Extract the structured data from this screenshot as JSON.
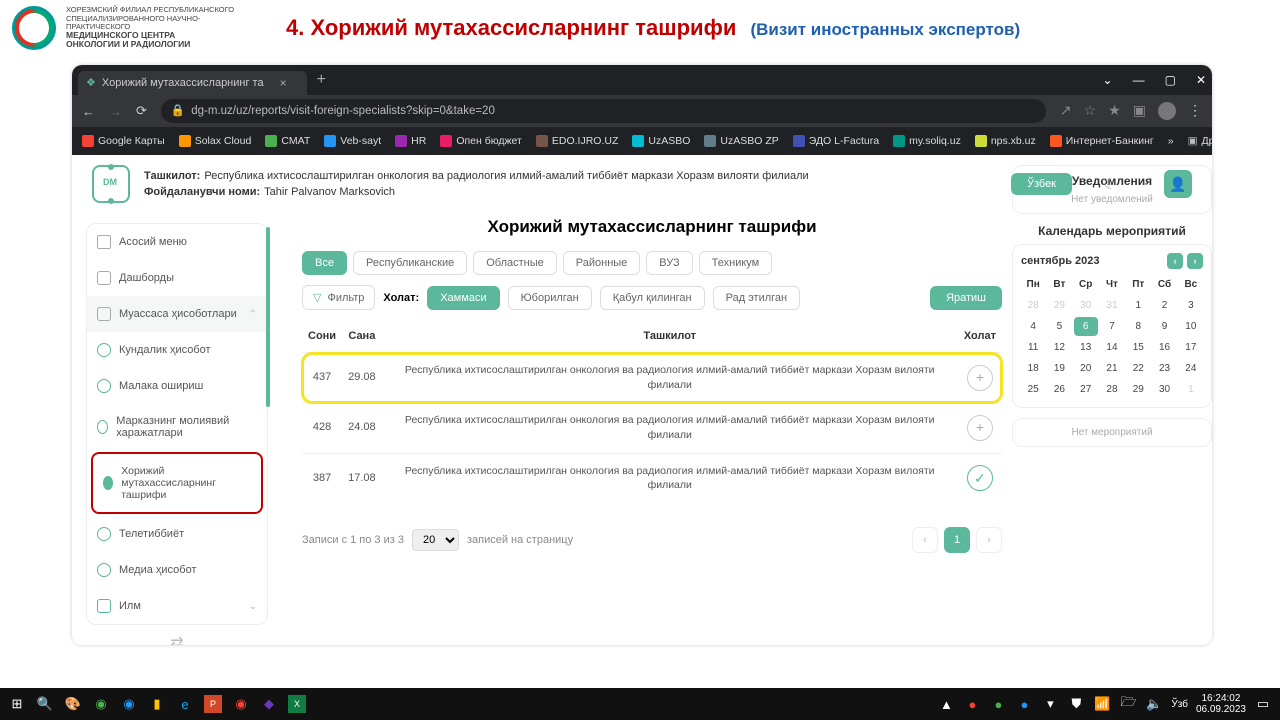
{
  "outer": {
    "org_line1": "ХОРЕЗМСКИЙ ФИЛИАЛ РЕСПУБЛИКАНСКОГО",
    "org_line2": "СПЕЦИАЛИЗИРОВАННОГО НАУЧНО-ПРАКТИЧЕСКОГО",
    "org_line3": "МЕДИЦИНСКОГО ЦЕНТРА",
    "org_line4": "ОНКОЛОГИИ И РАДИОЛОГИИ",
    "number": "4.",
    "title": "Хорижий мутахассисларнинг ташрифи",
    "subtitle": "(Визит иностранных экспертов)"
  },
  "chrome": {
    "tab": "Хорижий мутахассисларнинг та",
    "url": "dg-m.uz/uz/reports/visit-foreign-specialists?skip=0&take=20",
    "bookmarks": [
      "Google Карты",
      "Solax Cloud",
      "CMAT",
      "Veb-sayt",
      "HR",
      "Опен бюджет",
      "EDO.IJRO.UZ",
      "UzASBO",
      "UzASBO ZP",
      "ЭДО L-Factura",
      "my.soliq.uz",
      "nps.xb.uz",
      "Интернет-Банкинг"
    ],
    "bmk_more": "»",
    "bmk_folder": "Другие закладки"
  },
  "app": {
    "org_label": "Ташкилот:",
    "org_value": "Республика ихтисослаштирилган онкология ва радиология илмий-амалий тиббиёт маркази Хоразм вилояти филиали",
    "user_label": "Фойдаланувчи номи:",
    "user_value": "Tahir Palvanov Marksovich",
    "lang": "Ўзбек",
    "title": "Хорижий мутахассисларнинг ташрифи",
    "side": {
      "main_menu": "Асосий меню",
      "dashboards": "Дашборды",
      "institution": "Муассаса ҳисоботлари",
      "daily": "Кундалик ҳисобот",
      "training": "Малака ошириш",
      "finance": "Марказнинг молиявий харажатлари",
      "foreign": "Хорижий мутахассисларнинг ташрифи",
      "tele": "Телетиббиёт",
      "media": "Медиа ҳисобот",
      "science": "Илм"
    },
    "tabs": {
      "all": "Все",
      "rep": "Республиканские",
      "obl": "Областные",
      "ray": "Районные",
      "vuz": "ВУЗ",
      "teh": "Техникум"
    },
    "filter": {
      "button": "Фильтр",
      "label": "Холат:",
      "s1": "Хаммаси",
      "s2": "Юборилган",
      "s3": "Қабул қилинган",
      "s4": "Рад этилган",
      "create": "Яратиш"
    },
    "cols": {
      "count": "Сони",
      "date": "Сана",
      "org": "Ташкилот",
      "status": "Холат"
    },
    "rows": [
      {
        "count": "437",
        "date": "29.08",
        "org": "Республика ихтисослаштирилган онкология ва радиология илмий-амалий тиббиёт маркази Хоразм вилояти филиали",
        "hl": true,
        "ok": false
      },
      {
        "count": "428",
        "date": "24.08",
        "org": "Республика ихтисослаштирилган онкология ва радиология илмий-амалий тиббиёт маркази Хоразм вилояти филиали",
        "hl": false,
        "ok": false
      },
      {
        "count": "387",
        "date": "17.08",
        "org": "Республика ихтисослаштирилган онкология ва радиология илмий-амалий тиббиёт маркази Хоразм вилояти филиали",
        "hl": false,
        "ok": true
      }
    ],
    "pager": {
      "info": "Записи с 1 по 3 из 3",
      "per_page": "20",
      "tail": "записей на страницу",
      "cur": "1"
    },
    "right": {
      "notif_h": "Уведомления",
      "notif_empty": "Нет уведомлений",
      "cal_h": "Календарь мероприятий",
      "month": "сентябрь 2023",
      "dow": [
        "Пн",
        "Вт",
        "Ср",
        "Чт",
        "Пт",
        "Сб",
        "Вс"
      ],
      "days": [
        {
          "n": "28",
          "m": true
        },
        {
          "n": "29",
          "m": true
        },
        {
          "n": "30",
          "m": true
        },
        {
          "n": "31",
          "m": true
        },
        {
          "n": "1"
        },
        {
          "n": "2"
        },
        {
          "n": "3"
        },
        {
          "n": "4"
        },
        {
          "n": "5"
        },
        {
          "n": "6",
          "t": true
        },
        {
          "n": "7"
        },
        {
          "n": "8"
        },
        {
          "n": "9"
        },
        {
          "n": "10"
        },
        {
          "n": "11"
        },
        {
          "n": "12"
        },
        {
          "n": "13"
        },
        {
          "n": "14"
        },
        {
          "n": "15"
        },
        {
          "n": "16"
        },
        {
          "n": "17"
        },
        {
          "n": "18"
        },
        {
          "n": "19"
        },
        {
          "n": "20"
        },
        {
          "n": "21"
        },
        {
          "n": "22"
        },
        {
          "n": "23"
        },
        {
          "n": "24"
        },
        {
          "n": "25"
        },
        {
          "n": "26"
        },
        {
          "n": "27"
        },
        {
          "n": "28"
        },
        {
          "n": "29"
        },
        {
          "n": "30"
        },
        {
          "n": "1",
          "m": true
        }
      ],
      "ev_empty": "Нет мероприятий"
    }
  },
  "taskbar": {
    "lang": "Ўзб",
    "time": "16:24:02",
    "date": "06.09.2023"
  }
}
